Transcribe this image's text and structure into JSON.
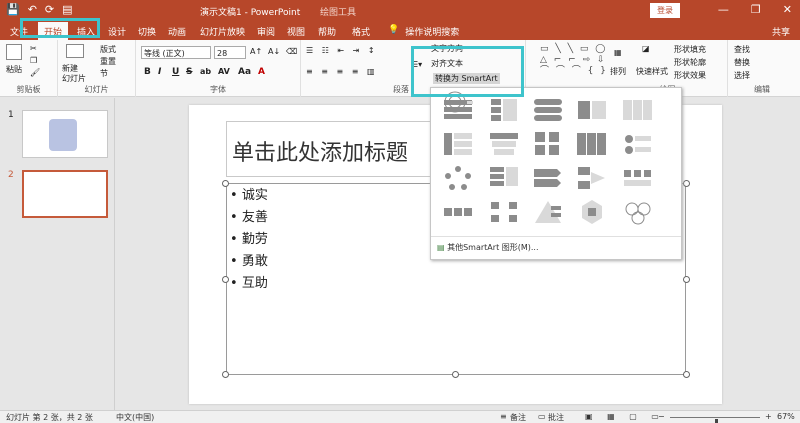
{
  "titlebar": {
    "qat": [
      "💾",
      "↶",
      "⟳",
      "▤"
    ],
    "title": "演示文稿1 - PowerPoint",
    "context": "绘图工具",
    "login": "登录",
    "min": "—",
    "restore": "❐",
    "close": "✕"
  },
  "tabs": [
    "文件",
    "开始",
    "插入",
    "设计",
    "切换",
    "动画",
    "幻灯片放映",
    "审阅",
    "视图",
    "帮助",
    "格式"
  ],
  "tell_me": "操作说明搜索",
  "share": "共享",
  "ribbon": {
    "clipboard": {
      "paste": "粘贴",
      "label": "剪贴板"
    },
    "slides": {
      "new_slide": "新建\n幻灯片",
      "layout": "版式",
      "reset": "重置",
      "section": "节",
      "label": "幻灯片"
    },
    "font": {
      "name": "等线 (正文)",
      "size": "28",
      "label": "字体",
      "buttons": [
        "B",
        "I",
        "U",
        "S",
        "ab",
        "AV",
        "Aa",
        "A"
      ]
    },
    "paragraph": {
      "label": "段落",
      "text_direction": "文字方向",
      "align_text": "对齐文本",
      "convert": "转换为 SmartArt"
    },
    "drawing": {
      "arrange": "排列",
      "quick_styles": "快速样式",
      "fill": "形状填充",
      "outline": "形状轮廓",
      "effects": "形状效果",
      "label": "绘图"
    },
    "editing": {
      "find": "查找",
      "replace": "替换",
      "select": "选择",
      "label": "编辑"
    }
  },
  "thumbnails": [
    {
      "num": "1"
    },
    {
      "num": "2"
    }
  ],
  "slide": {
    "title": "单击此处添加标题",
    "bullets": [
      "诚实",
      "友善",
      "勤劳",
      "勇敢",
      "互助"
    ]
  },
  "dropdown": {
    "more": "其他SmartArt 图形(M)..."
  },
  "status": {
    "slide_info": "幻灯片 第 2 张，共 2 张",
    "language": "中文(中国)",
    "notes": "备注",
    "comments": "批注",
    "zoom": "67%",
    "zoom_level": 0.67
  },
  "colors": {
    "accent": "#b7472a",
    "highlight": "#3ec4cc"
  }
}
